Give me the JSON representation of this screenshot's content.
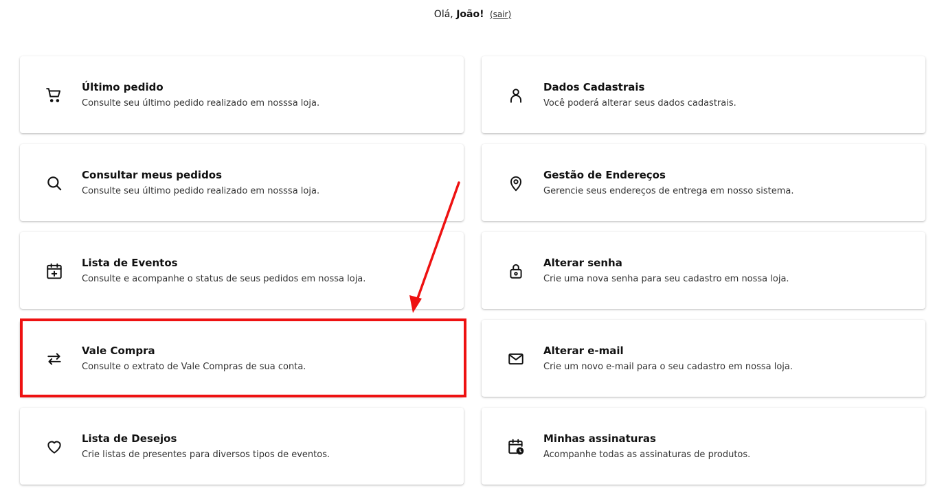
{
  "header": {
    "greeting_prefix": "Olá,",
    "user_name": "João!",
    "logout_label": "(sair)"
  },
  "cards": [
    {
      "title": "Último pedido",
      "description": "Consulte seu último pedido realizado em nosssa loja.",
      "icon": "cart-icon"
    },
    {
      "title": "Dados Cadastrais",
      "description": "Você poderá alterar seus dados cadastrais.",
      "icon": "user-icon"
    },
    {
      "title": "Consultar meus pedidos",
      "description": "Consulte seu último pedido realizado em nosssa loja.",
      "icon": "search-icon"
    },
    {
      "title": "Gestão de Endereços",
      "description": "Gerencie seus endereços de entrega em nosso sistema.",
      "icon": "location-pin-icon"
    },
    {
      "title": "Lista de Eventos",
      "description": "Consulte e acompanhe o status de seus pedidos em nossa loja.",
      "icon": "calendar-plus-icon"
    },
    {
      "title": "Alterar senha",
      "description": "Crie uma nova senha para seu cadastro em nossa loja.",
      "icon": "lock-icon"
    },
    {
      "title": "Vale Compra",
      "description": "Consulte o extrato de Vale Compras de sua conta.",
      "icon": "exchange-arrows-icon"
    },
    {
      "title": "Alterar e-mail",
      "description": "Crie um novo e-mail para o seu cadastro em nossa loja.",
      "icon": "envelope-icon"
    },
    {
      "title": "Lista de Desejos",
      "description": "Crie listas de presentes para diversos tipos de eventos.",
      "icon": "heart-icon"
    },
    {
      "title": "Minhas assinaturas",
      "description": "Acompanhe todas as assinaturas de produtos.",
      "icon": "calendar-clock-icon"
    }
  ],
  "annotation": {
    "highlight_color": "#ee1111",
    "highlighted_card": "Vale Compra"
  }
}
